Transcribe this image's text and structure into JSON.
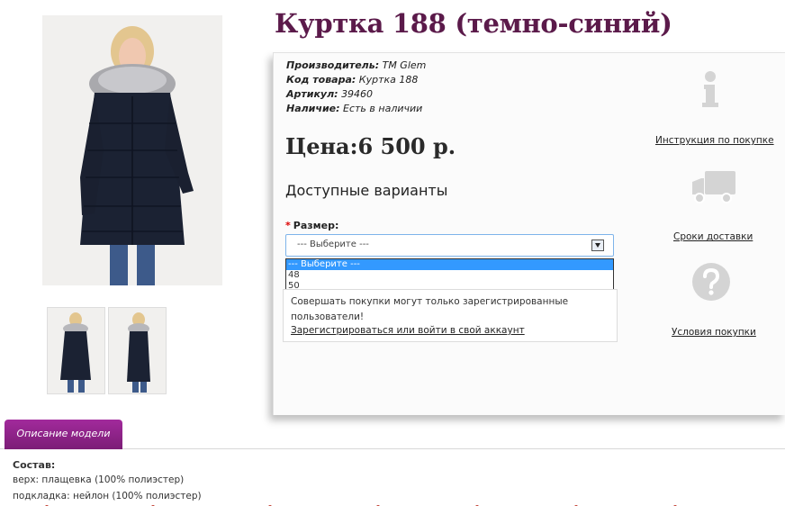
{
  "product": {
    "title": "Куртка 188 (темно-синий)",
    "manufacturer_label": "Производитель:",
    "manufacturer_value": "ТМ Glem",
    "code_label": "Код товара:",
    "code_value": "Куртка 188",
    "article_label": "Артикул:",
    "article_value": "39460",
    "availability_label": "Наличие:",
    "availability_value": "Есть в наличии",
    "price": "Цена:6 500 р."
  },
  "options": {
    "title": "Доступные варианты",
    "size_label": "Размер:",
    "size_select": {
      "value": "--- Выберите ---",
      "items": [
        "--- Выберите ---",
        "48",
        "50"
      ],
      "selected_index": 0
    }
  },
  "notice": {
    "text": "Совершать покупки могут только зарегистрированные пользователи!",
    "link": "Зарегистрироваться или войти в свой аккаунт"
  },
  "side_links": {
    "instruction": "Инструкция по покупке",
    "delivery": "Сроки доставки",
    "terms": "Условия покупки"
  },
  "tabs": {
    "description": "Описание модели"
  },
  "description": {
    "heading": "Состав:",
    "lines": [
      "верх: плащевка (100% полиэстер)",
      "подкладка: нейлон (100% полиэстер)"
    ]
  },
  "icons": {
    "main_image": "coat-photo",
    "thumbnails": [
      "coat-front-photo",
      "coat-side-photo"
    ],
    "instruction": "info-icon",
    "delivery": "truck-icon",
    "terms": "question-icon",
    "dropdown_arrow": "chevron-down-icon"
  },
  "colors": {
    "title": "#5b1a4a",
    "tab": "#8e238a",
    "select_highlight": "#3399ff"
  }
}
